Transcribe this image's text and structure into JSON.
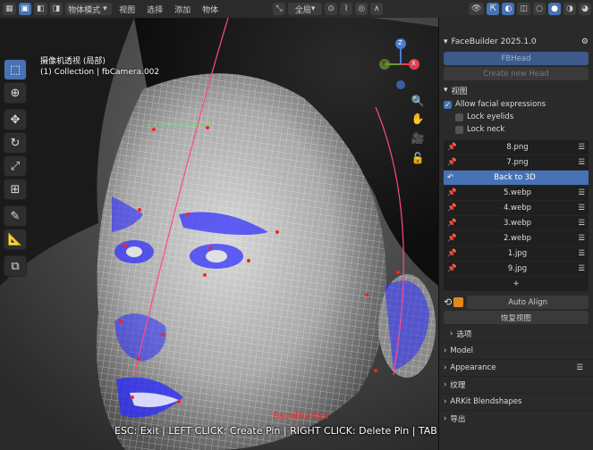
{
  "topbar": {
    "mode": "物体模式",
    "menus": [
      "视图",
      "选择",
      "添加",
      "物体"
    ],
    "transform": "全局"
  },
  "viewport": {
    "title": "摄像机透视 (局部)",
    "subtitle": "(1) Collection | fbCamera.002",
    "gizmo": {
      "z": "Z",
      "y": "Y",
      "x": "X"
    },
    "status": "ESC: Exit | LEFT CLICK: Create Pin | RIGHT CLICK: Delete Pin | TAB",
    "watermark": "FaceBuilder"
  },
  "panel": {
    "title": "FaceBuilder 2025.1.0",
    "head_btn": "FBHead",
    "create_btn": "Create new Head",
    "view_section": "视图",
    "allow_expressions": "Allow facial expressions",
    "lock_eyelids": "Lock eyelids",
    "lock_neck": "Lock neck",
    "images": [
      "8.png",
      "7.png",
      "Back to 3D",
      "5.webp",
      "4.webp",
      "3.webp",
      "2.webp",
      "1.jpg",
      "9.jpg"
    ],
    "add": "+",
    "auto_align": "Auto Align",
    "restore_view": "恢复视图",
    "options": "选项",
    "model": "Model",
    "appearance": "Appearance",
    "texture": "纹理",
    "arkit": "ARKit Blendshapes",
    "export": "导出"
  },
  "colors": {
    "accent": "#4772b3",
    "mesh": "#ffffff",
    "pins": "#ff2020",
    "blue": "#2a2aff"
  }
}
